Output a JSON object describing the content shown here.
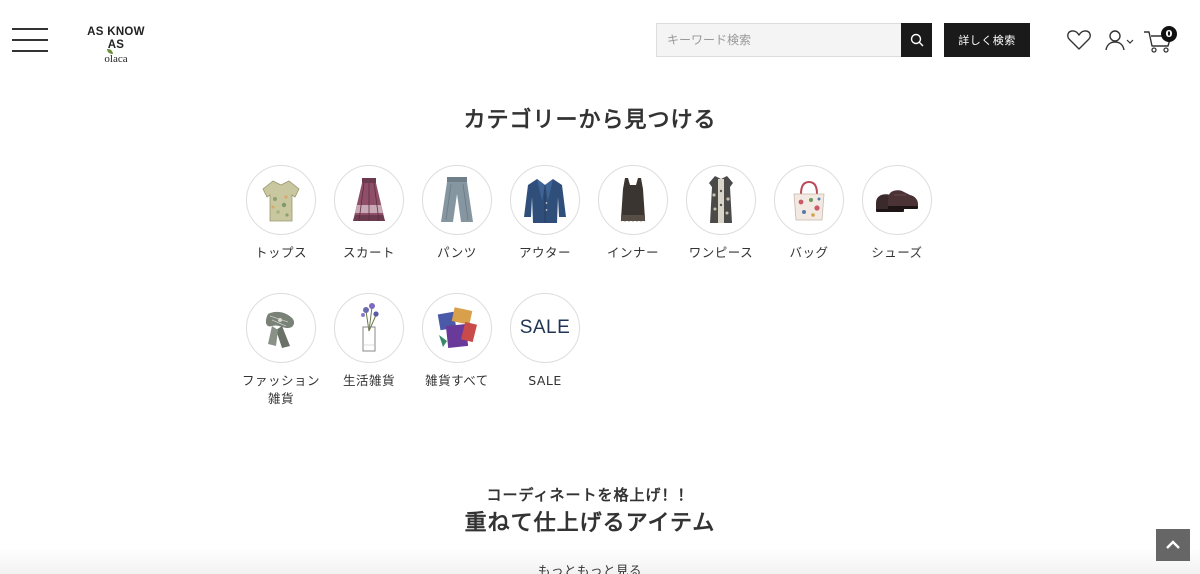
{
  "header": {
    "logo": {
      "line1": "AS KNOW AS",
      "line2": "olaca"
    },
    "search": {
      "placeholder": "キーワード検索",
      "value": ""
    },
    "detail_search_label": "詳しく検索",
    "cart_count": "0"
  },
  "categories": {
    "title": "カテゴリーから見つける",
    "items": [
      {
        "label": "トップス",
        "icon": "blouse-image"
      },
      {
        "label": "スカート",
        "icon": "skirt-image"
      },
      {
        "label": "パンツ",
        "icon": "pants-image"
      },
      {
        "label": "アウター",
        "icon": "jacket-image"
      },
      {
        "label": "インナー",
        "icon": "tank-top-image"
      },
      {
        "label": "ワンピース",
        "icon": "dress-image"
      },
      {
        "label": "バッグ",
        "icon": "tote-bag-image"
      },
      {
        "label": "シューズ",
        "icon": "shoes-image"
      },
      {
        "label": "ファッション雑貨",
        "icon": "scarf-image"
      },
      {
        "label": "生活雑貨",
        "icon": "vase-image"
      },
      {
        "label": "雑貨すべて",
        "icon": "goods-image"
      },
      {
        "label": "SALE",
        "icon": "sale-image",
        "circle_text": "SALE"
      }
    ]
  },
  "coordinate": {
    "subtitle": "コーディネートを格上げ！！",
    "title": "重ねて仕上げるアイテム",
    "more_label": "もっともっと見る"
  },
  "colors": {
    "accent_dark": "#1a1a1a",
    "sale_text": "#1f3552",
    "back_to_top": "#666666"
  }
}
